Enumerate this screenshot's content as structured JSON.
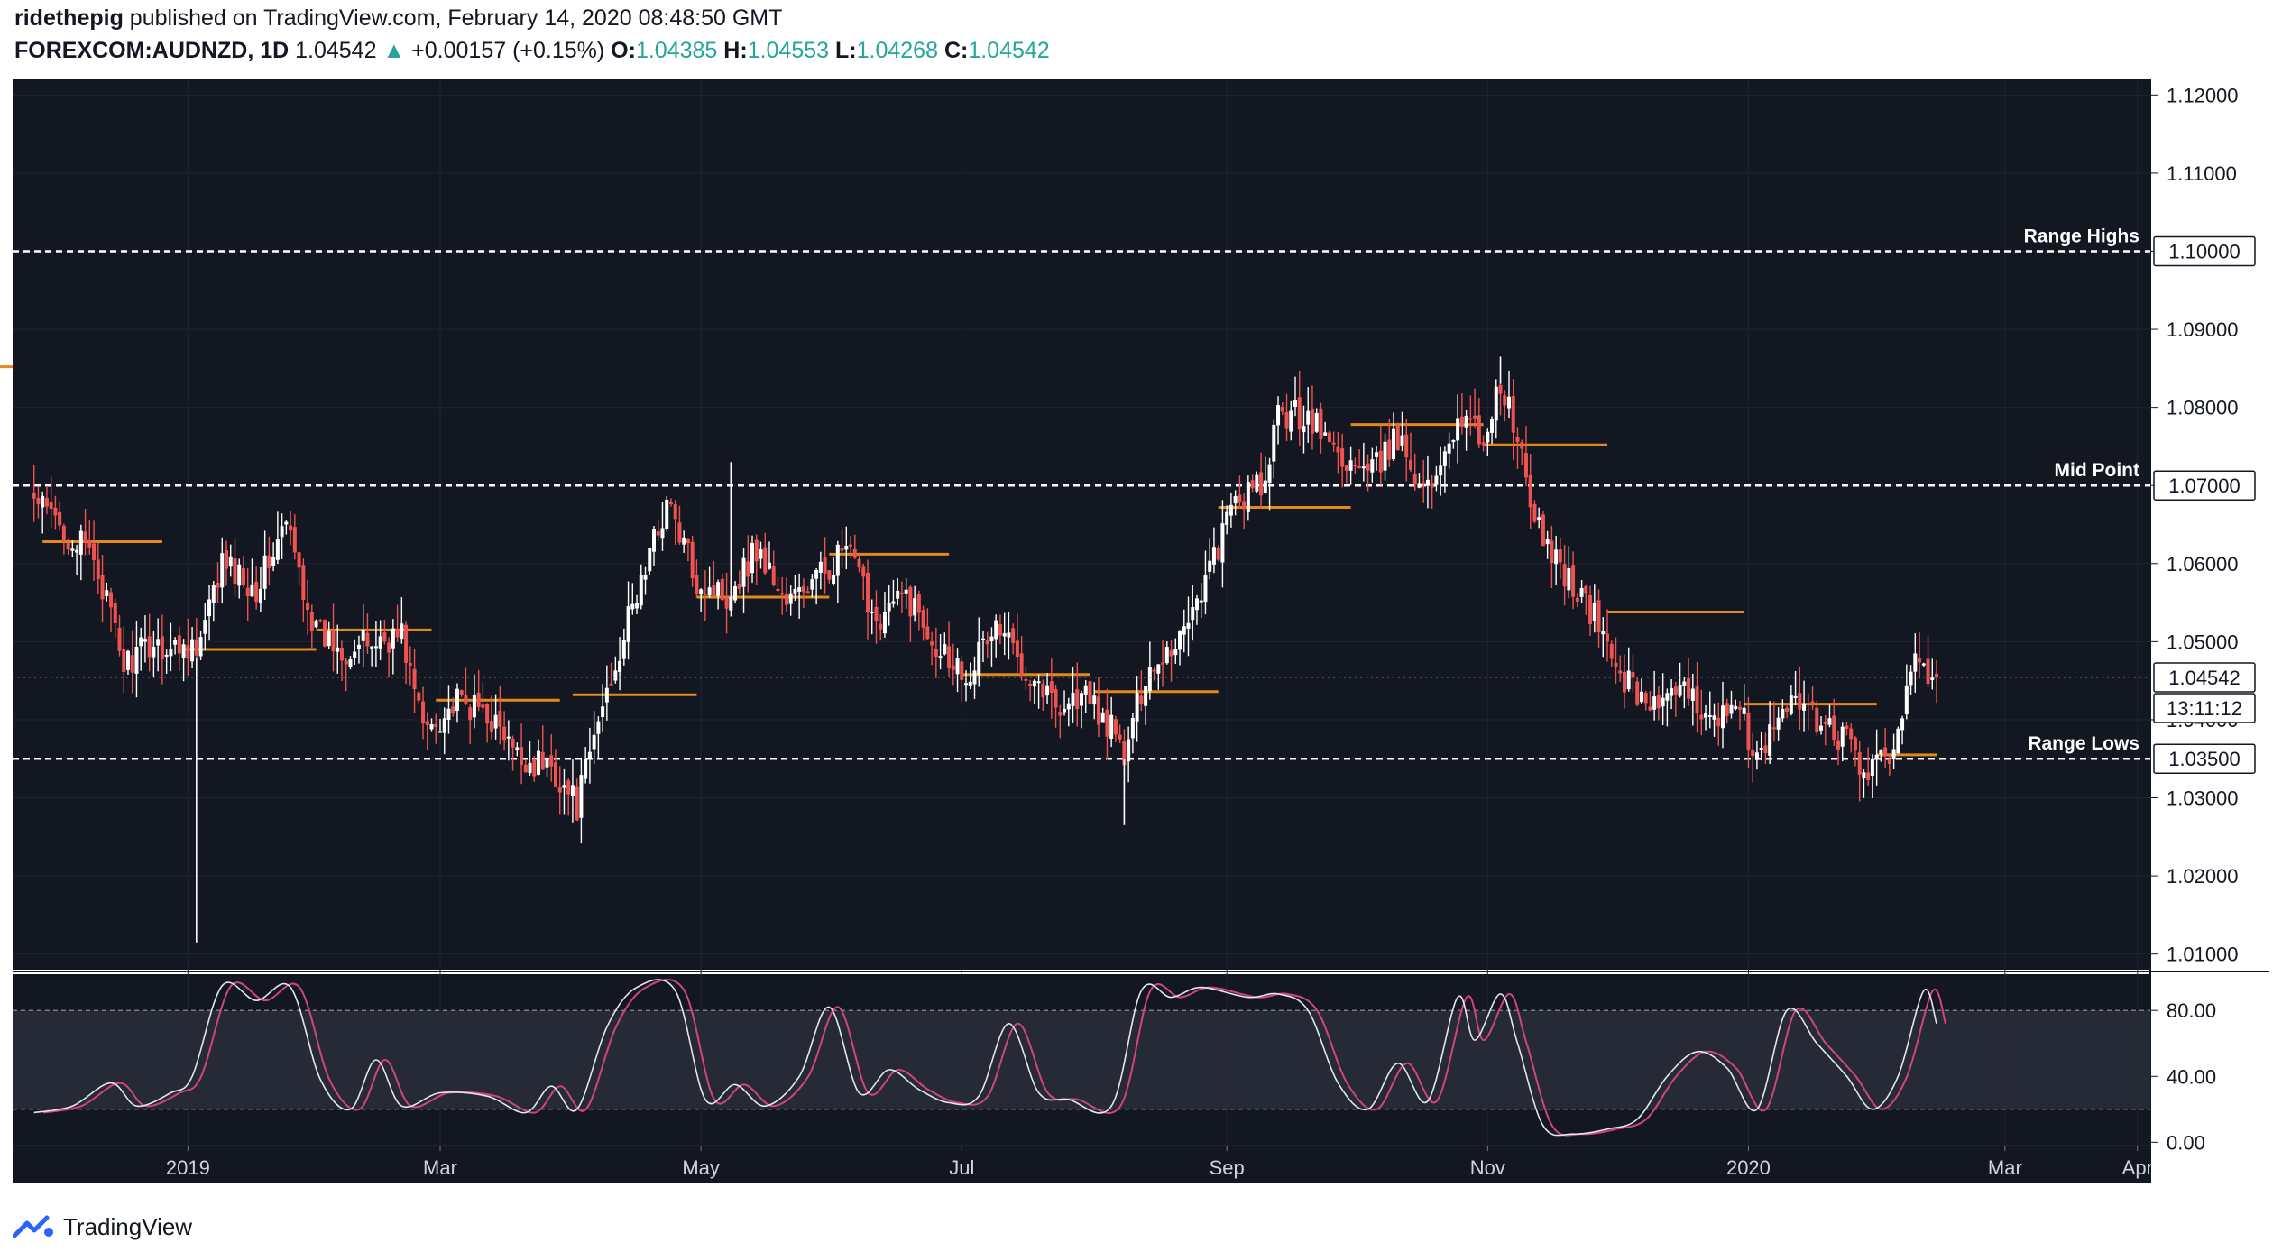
{
  "header": {
    "author": "ridethepig",
    "published_text": "published on TradingView.com, February 14, 2020 08:48:50 GMT",
    "symbol": "FOREXCOM:AUDNZD, 1D",
    "last": "1.04542",
    "change_arrow": "▲",
    "change": "+0.00157 (+0.15%)",
    "o_label": "O:",
    "o_value": "1.04385",
    "h_label": "H:",
    "h_value": "1.04553",
    "l_label": "L:",
    "l_value": "1.04268",
    "c_label": "C:",
    "c_value": "1.04542"
  },
  "footer": {
    "brand": "TradingView"
  },
  "colors": {
    "background": "#131722",
    "up": "#ffffff",
    "down": "#ef5350",
    "level": "#e08a1e",
    "stoch_k": "#e3e6ee",
    "stoch_d": "#d0457a",
    "header_green": "#26a69a"
  },
  "chart_data": {
    "type": "candlestick",
    "price_axis": {
      "ylim": [
        1.008,
        1.122
      ],
      "ticks": [
        "1.12000",
        "1.11000",
        "1.10000",
        "1.09000",
        "1.08000",
        "1.07000",
        "1.06000",
        "1.05000",
        "1.04000",
        "1.03000",
        "1.02000",
        "1.01000"
      ],
      "last_price_label": "1.04542",
      "countdown_label": "13:11:12"
    },
    "time_axis": {
      "ticks": [
        {
          "label": "2019",
          "date": "2019-01-01"
        },
        {
          "label": "Mar",
          "date": "2019-03-01"
        },
        {
          "label": "May",
          "date": "2019-05-01"
        },
        {
          "label": "Jul",
          "date": "2019-07-01"
        },
        {
          "label": "Sep",
          "date": "2019-09-01"
        },
        {
          "label": "Nov",
          "date": "2019-11-01"
        },
        {
          "label": "2020",
          "date": "2020-01-01"
        },
        {
          "label": "Mar",
          "date": "2020-03-01"
        },
        {
          "label": "Apr",
          "date": "2020-04-01"
        }
      ]
    },
    "horizontal_levels": [
      {
        "name": "Range Highs",
        "value": 1.1,
        "axis_label": "1.10000"
      },
      {
        "name": "Mid Point",
        "value": 1.07,
        "axis_label": "1.07000"
      },
      {
        "name": "Range Lows",
        "value": 1.035,
        "axis_label": "1.03500"
      }
    ],
    "monthly_levels": [
      {
        "from": "2018-10-31",
        "to": "2018-11-21",
        "value": 1.0852
      },
      {
        "from": "2018-11-28",
        "to": "2018-12-26",
        "value": 1.0628
      },
      {
        "from": "2018-12-31",
        "to": "2019-01-31",
        "value": 1.049
      },
      {
        "from": "2019-01-31",
        "to": "2019-02-27",
        "value": 1.0515
      },
      {
        "from": "2019-02-28",
        "to": "2019-03-29",
        "value": 1.0425
      },
      {
        "from": "2019-04-01",
        "to": "2019-04-30",
        "value": 1.0432
      },
      {
        "from": "2019-04-30",
        "to": "2019-05-31",
        "value": 1.0557
      },
      {
        "from": "2019-05-31",
        "to": "2019-06-28",
        "value": 1.0612
      },
      {
        "from": "2019-07-01",
        "to": "2019-07-31",
        "value": 1.0458
      },
      {
        "from": "2019-08-01",
        "to": "2019-08-30",
        "value": 1.0436
      },
      {
        "from": "2019-08-30",
        "to": "2019-09-30",
        "value": 1.0672
      },
      {
        "from": "2019-09-30",
        "to": "2019-10-31",
        "value": 1.0778
      },
      {
        "from": "2019-10-31",
        "to": "2019-11-29",
        "value": 1.0752
      },
      {
        "from": "2019-11-29",
        "to": "2019-12-31",
        "value": 1.0538
      },
      {
        "from": "2019-12-31",
        "to": "2020-01-31",
        "value": 1.042
      },
      {
        "from": "2020-01-31",
        "to": "2020-02-14",
        "value": 1.0355
      }
    ],
    "close_path": [
      {
        "date": "2018-11-26",
        "close": 1.068
      },
      {
        "date": "2018-11-30",
        "close": 1.066
      },
      {
        "date": "2018-12-05",
        "close": 1.063
      },
      {
        "date": "2018-12-10",
        "close": 1.061
      },
      {
        "date": "2018-12-17",
        "close": 1.047
      },
      {
        "date": "2018-12-24",
        "close": 1.05
      },
      {
        "date": "2018-12-28",
        "close": 1.049
      },
      {
        "date": "2019-01-02",
        "close": 1.05
      },
      {
        "date": "2019-01-03",
        "close": 1.048
      },
      {
        "date": "2019-01-09",
        "close": 1.06
      },
      {
        "date": "2019-01-17",
        "close": 1.057
      },
      {
        "date": "2019-01-24",
        "close": 1.065
      },
      {
        "date": "2019-01-31",
        "close": 1.051
      },
      {
        "date": "2019-02-07",
        "close": 1.049
      },
      {
        "date": "2019-02-14",
        "close": 1.05
      },
      {
        "date": "2019-02-20",
        "close": 1.051
      },
      {
        "date": "2019-02-25",
        "close": 1.039
      },
      {
        "date": "2019-03-05",
        "close": 1.042
      },
      {
        "date": "2019-03-12",
        "close": 1.041
      },
      {
        "date": "2019-03-19",
        "close": 1.035
      },
      {
        "date": "2019-03-27",
        "close": 1.034
      },
      {
        "date": "2019-04-02",
        "close": 1.029
      },
      {
        "date": "2019-04-09",
        "close": 1.044
      },
      {
        "date": "2019-04-16",
        "close": 1.056
      },
      {
        "date": "2019-04-23",
        "close": 1.068
      },
      {
        "date": "2019-04-30",
        "close": 1.058
      },
      {
        "date": "2019-05-07",
        "close": 1.056
      },
      {
        "date": "2019-05-14",
        "close": 1.062
      },
      {
        "date": "2019-05-21",
        "close": 1.055
      },
      {
        "date": "2019-05-28",
        "close": 1.058
      },
      {
        "date": "2019-06-04",
        "close": 1.062
      },
      {
        "date": "2019-06-11",
        "close": 1.053
      },
      {
        "date": "2019-06-18",
        "close": 1.056
      },
      {
        "date": "2019-06-25",
        "close": 1.05
      },
      {
        "date": "2019-07-02",
        "close": 1.046
      },
      {
        "date": "2019-07-09",
        "close": 1.052
      },
      {
        "date": "2019-07-16",
        "close": 1.047
      },
      {
        "date": "2019-07-23",
        "close": 1.042
      },
      {
        "date": "2019-07-30",
        "close": 1.043
      },
      {
        "date": "2019-08-06",
        "close": 1.038
      },
      {
        "date": "2019-08-08",
        "close": 1.035
      },
      {
        "date": "2019-08-13",
        "close": 1.046
      },
      {
        "date": "2019-08-20",
        "close": 1.05
      },
      {
        "date": "2019-08-27",
        "close": 1.058
      },
      {
        "date": "2019-09-03",
        "close": 1.068
      },
      {
        "date": "2019-09-10",
        "close": 1.07
      },
      {
        "date": "2019-09-13",
        "close": 1.079
      },
      {
        "date": "2019-09-20",
        "close": 1.079
      },
      {
        "date": "2019-09-27",
        "close": 1.074
      },
      {
        "date": "2019-10-04",
        "close": 1.071
      },
      {
        "date": "2019-10-11",
        "close": 1.076
      },
      {
        "date": "2019-10-18",
        "close": 1.069
      },
      {
        "date": "2019-10-25",
        "close": 1.079
      },
      {
        "date": "2019-10-31",
        "close": 1.076
      },
      {
        "date": "2019-11-04",
        "close": 1.083
      },
      {
        "date": "2019-11-08",
        "close": 1.076
      },
      {
        "date": "2019-11-12",
        "close": 1.065
      },
      {
        "date": "2019-11-19",
        "close": 1.059
      },
      {
        "date": "2019-11-26",
        "close": 1.053
      },
      {
        "date": "2019-12-03",
        "close": 1.045
      },
      {
        "date": "2019-12-10",
        "close": 1.042
      },
      {
        "date": "2019-12-17",
        "close": 1.043
      },
      {
        "date": "2019-12-24",
        "close": 1.041
      },
      {
        "date": "2019-12-31",
        "close": 1.04
      },
      {
        "date": "2020-01-03",
        "close": 1.034
      },
      {
        "date": "2020-01-10",
        "close": 1.043
      },
      {
        "date": "2020-01-17",
        "close": 1.04
      },
      {
        "date": "2020-01-24",
        "close": 1.037
      },
      {
        "date": "2020-01-29",
        "close": 1.033
      },
      {
        "date": "2020-02-03",
        "close": 1.035
      },
      {
        "date": "2020-02-07",
        "close": 1.044
      },
      {
        "date": "2020-02-11",
        "close": 1.049
      },
      {
        "date": "2020-02-12",
        "close": 1.043
      },
      {
        "date": "2020-02-14",
        "close": 1.0454
      }
    ],
    "notable_wicks": [
      {
        "date": "2019-01-03",
        "low": 1.0115
      },
      {
        "date": "2019-05-08",
        "high": 1.073
      },
      {
        "date": "2019-08-08",
        "low": 1.0265
      },
      {
        "date": "2019-11-04",
        "high": 1.0865
      }
    ],
    "stochastic": {
      "ticks": [
        "80.00",
        "40.00",
        "0.00"
      ],
      "ylim": [
        -2,
        102
      ],
      "upper_band": 80,
      "lower_band": 20,
      "k_path": [
        {
          "date": "2018-11-26",
          "value": 18
        },
        {
          "date": "2018-12-05",
          "value": 22
        },
        {
          "date": "2018-12-14",
          "value": 36
        },
        {
          "date": "2018-12-20",
          "value": 22
        },
        {
          "date": "2018-12-28",
          "value": 30
        },
        {
          "date": "2019-01-02",
          "value": 40
        },
        {
          "date": "2019-01-09",
          "value": 95
        },
        {
          "date": "2019-01-17",
          "value": 86
        },
        {
          "date": "2019-01-25",
          "value": 94
        },
        {
          "date": "2019-02-01",
          "value": 38
        },
        {
          "date": "2019-02-08",
          "value": 20
        },
        {
          "date": "2019-02-14",
          "value": 50
        },
        {
          "date": "2019-02-20",
          "value": 22
        },
        {
          "date": "2019-03-01",
          "value": 30
        },
        {
          "date": "2019-03-12",
          "value": 28
        },
        {
          "date": "2019-03-21",
          "value": 18
        },
        {
          "date": "2019-03-27",
          "value": 34
        },
        {
          "date": "2019-04-02",
          "value": 20
        },
        {
          "date": "2019-04-09",
          "value": 70
        },
        {
          "date": "2019-04-16",
          "value": 94
        },
        {
          "date": "2019-04-25",
          "value": 92
        },
        {
          "date": "2019-05-02",
          "value": 26
        },
        {
          "date": "2019-05-09",
          "value": 35
        },
        {
          "date": "2019-05-16",
          "value": 22
        },
        {
          "date": "2019-05-24",
          "value": 40
        },
        {
          "date": "2019-05-31",
          "value": 82
        },
        {
          "date": "2019-06-07",
          "value": 30
        },
        {
          "date": "2019-06-14",
          "value": 44
        },
        {
          "date": "2019-06-21",
          "value": 32
        },
        {
          "date": "2019-06-28",
          "value": 24
        },
        {
          "date": "2019-07-05",
          "value": 28
        },
        {
          "date": "2019-07-12",
          "value": 72
        },
        {
          "date": "2019-07-19",
          "value": 30
        },
        {
          "date": "2019-07-26",
          "value": 26
        },
        {
          "date": "2019-08-05",
          "value": 22
        },
        {
          "date": "2019-08-12",
          "value": 92
        },
        {
          "date": "2019-08-19",
          "value": 88
        },
        {
          "date": "2019-08-26",
          "value": 94
        },
        {
          "date": "2019-09-06",
          "value": 88
        },
        {
          "date": "2019-09-13",
          "value": 90
        },
        {
          "date": "2019-09-20",
          "value": 80
        },
        {
          "date": "2019-09-27",
          "value": 36
        },
        {
          "date": "2019-10-04",
          "value": 20
        },
        {
          "date": "2019-10-11",
          "value": 48
        },
        {
          "date": "2019-10-18",
          "value": 25
        },
        {
          "date": "2019-10-25",
          "value": 88
        },
        {
          "date": "2019-10-29",
          "value": 62
        },
        {
          "date": "2019-11-04",
          "value": 90
        },
        {
          "date": "2019-11-08",
          "value": 60
        },
        {
          "date": "2019-11-14",
          "value": 10
        },
        {
          "date": "2019-11-21",
          "value": 5
        },
        {
          "date": "2019-11-29",
          "value": 8
        },
        {
          "date": "2019-12-06",
          "value": 14
        },
        {
          "date": "2019-12-13",
          "value": 40
        },
        {
          "date": "2019-12-20",
          "value": 55
        },
        {
          "date": "2019-12-27",
          "value": 45
        },
        {
          "date": "2020-01-03",
          "value": 20
        },
        {
          "date": "2020-01-10",
          "value": 80
        },
        {
          "date": "2020-01-17",
          "value": 60
        },
        {
          "date": "2020-01-24",
          "value": 40
        },
        {
          "date": "2020-01-30",
          "value": 20
        },
        {
          "date": "2020-02-05",
          "value": 40
        },
        {
          "date": "2020-02-11",
          "value": 92
        },
        {
          "date": "2020-02-14",
          "value": 72
        }
      ]
    }
  }
}
